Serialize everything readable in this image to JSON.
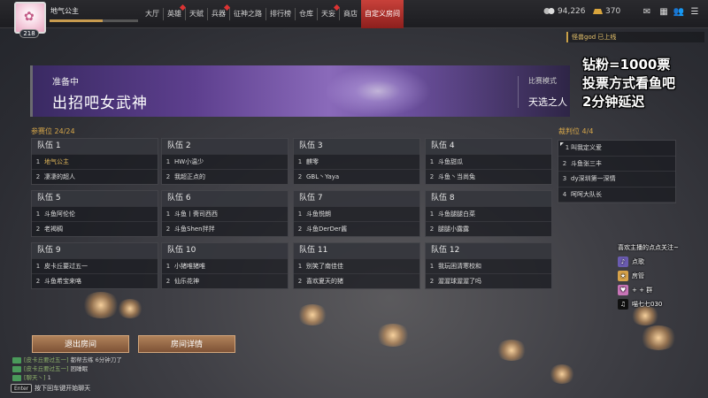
{
  "player": {
    "name": "地气公主",
    "level": "218",
    "avatar_icon": "bunny-avatar-icon"
  },
  "nav": [
    {
      "label": "大厅",
      "dot": false
    },
    {
      "label": "英雄",
      "dot": true
    },
    {
      "label": "天赋",
      "dot": false
    },
    {
      "label": "兵器",
      "dot": true
    },
    {
      "label": "征神之路",
      "dot": false
    },
    {
      "label": "排行榜",
      "dot": false
    },
    {
      "label": "仓库",
      "dot": false
    },
    {
      "label": "天妄",
      "dot": true
    },
    {
      "label": "商店",
      "dot": false
    },
    {
      "label": "自定义房间",
      "dot": false,
      "active": true
    }
  ],
  "currency": {
    "coins": "94,226",
    "gold": "370"
  },
  "notice": "怪兽god 已上线",
  "banner": {
    "status": "准备中",
    "title": "出招吧女武神",
    "mode_label": "比赛模式",
    "mode_value": "天选之人"
  },
  "participants_label": "参赛位 24/24",
  "judges_label": "裁判位 4/4",
  "teams": [
    {
      "name": "队伍 1",
      "players": [
        {
          "n": "1",
          "name": "地气公主",
          "gold": true
        },
        {
          "n": "2",
          "name": "凄凄的超人"
        }
      ]
    },
    {
      "name": "队伍 2",
      "players": [
        {
          "n": "1",
          "name": "HW小温少"
        },
        {
          "n": "2",
          "name": "我超正点的"
        }
      ]
    },
    {
      "name": "队伍 3",
      "players": [
        {
          "n": "1",
          "name": "麒零"
        },
        {
          "n": "2",
          "name": "GBL丶Yaya"
        }
      ]
    },
    {
      "name": "队伍 4",
      "players": [
        {
          "n": "1",
          "name": "斗鱼甜瓜"
        },
        {
          "n": "2",
          "name": "斗鱼丶当尚兔"
        }
      ]
    },
    {
      "name": "队伍 5",
      "players": [
        {
          "n": "1",
          "name": "斗鱼阿伦伦"
        },
        {
          "n": "2",
          "name": "老褐稠"
        }
      ]
    },
    {
      "name": "队伍 6",
      "players": [
        {
          "n": "1",
          "name": "斗鱼丨斋司西西"
        },
        {
          "n": "2",
          "name": "斗鱼Shen拌拌"
        }
      ]
    },
    {
      "name": "队伍 7",
      "players": [
        {
          "n": "1",
          "name": "斗鱼悦朗"
        },
        {
          "n": "2",
          "name": "斗鱼DerDer酱"
        }
      ]
    },
    {
      "name": "队伍 8",
      "players": [
        {
          "n": "1",
          "name": "斗鱼腿腿白菜"
        },
        {
          "n": "2",
          "name": "腿腿小露露"
        }
      ]
    },
    {
      "name": "队伍 9",
      "players": [
        {
          "n": "1",
          "name": "皮卡丘要过五一"
        },
        {
          "n": "2",
          "name": "斗鱼希宝来咯"
        }
      ]
    },
    {
      "name": "队伍 10",
      "players": [
        {
          "n": "1",
          "name": "小猪唯猪唯"
        },
        {
          "n": "2",
          "name": "仙乐花神"
        }
      ]
    },
    {
      "name": "队伍 11",
      "players": [
        {
          "n": "1",
          "name": "别笑了南佳佳"
        },
        {
          "n": "2",
          "name": "喜欢夏天的猪"
        }
      ]
    },
    {
      "name": "队伍 12",
      "players": [
        {
          "n": "1",
          "name": "我玩困清寒校和"
        },
        {
          "n": "2",
          "name": "渥渥球渥渥了吗"
        }
      ]
    }
  ],
  "judges": [
    {
      "n": "1",
      "name": "叫我定义爱"
    },
    {
      "n": "2",
      "name": "斗鱼张三丰"
    },
    {
      "n": "3",
      "name": "dy深圳第一深情"
    },
    {
      "n": "4",
      "name": "呵呵大队长"
    }
  ],
  "overlay": [
    "钻粉=1000票",
    "投票方式看鱼吧",
    "2分钟延迟"
  ],
  "fans": {
    "title": "喜欢主播的点点关注~",
    "rows": [
      "点歌",
      "房管",
      "+  + 群",
      "喵七七030"
    ]
  },
  "buttons": {
    "exit": "退出房间",
    "details": "房间详情"
  },
  "chat": [
    {
      "prefix": "[皮卡丘要过五一]",
      "text": "都帮去练 6分钟刀了"
    },
    {
      "prefix": "[皮卡丘要过五一]",
      "text": "困睡眠"
    },
    {
      "prefix": "[聊天丶]",
      "text": "1"
    }
  ],
  "chat_hint": {
    "key": "Enter",
    "text": "按下回车键开始聊天"
  },
  "colors": {
    "accent_gold": "#d7a74a",
    "active_tab": "#b8342f",
    "banner_purple": "#5d3f8e"
  }
}
